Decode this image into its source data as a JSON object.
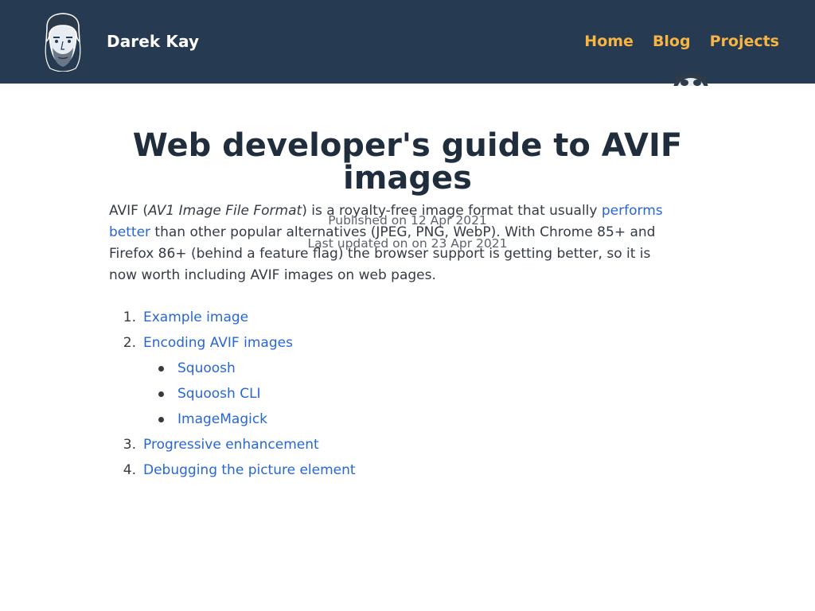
{
  "header": {
    "brand_name": "Darek Kay",
    "nav": [
      {
        "label": "Home"
      },
      {
        "label": "Blog"
      },
      {
        "label": "Projects"
      }
    ]
  },
  "article": {
    "title": "Web developer's guide to AVIF images",
    "published": "Published on 12 Apr 2021",
    "updated": "Last updated on on 23 Apr 2021",
    "intro": {
      "p1": "AVIF (",
      "em": "AV1 Image File Format",
      "p2": ") is a royalty-free image format that usually ",
      "link": "performs better",
      "p3": " than other popular alternatives (JPEG, PNG, WebP). With Chrome 85+ and Firefox 86+ (behind a feature flag) the browser support is getting better, so it is now worth including AVIF images on web pages."
    },
    "toc": [
      {
        "num": "1.",
        "label": "Example image"
      },
      {
        "num": "2.",
        "label": "Encoding AVIF images",
        "children": [
          "Squoosh",
          "Squoosh CLI",
          "ImageMagick"
        ]
      },
      {
        "num": "3.",
        "label": "Progressive enhancement"
      },
      {
        "num": "4.",
        "label": "Debugging the picture element"
      }
    ]
  },
  "colors": {
    "header_bg": "#263a52",
    "nav_link": "#f6b443",
    "link": "#2767d4",
    "title": "#1f2d3d"
  }
}
